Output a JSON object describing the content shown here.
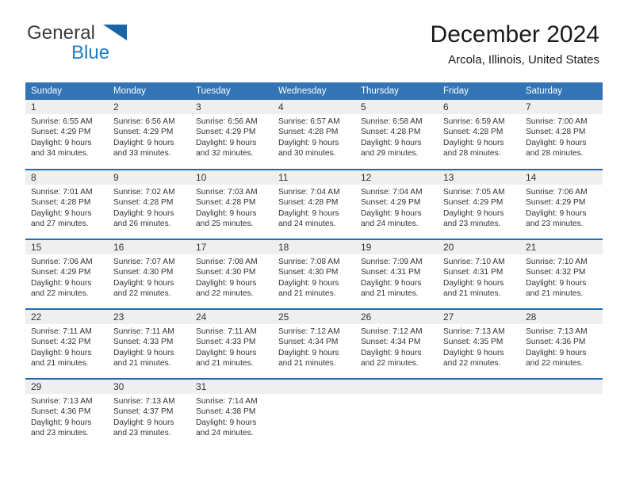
{
  "brand": {
    "name_part1": "General",
    "name_part2": "Blue",
    "triangle_color": "#1666a8",
    "blue_color": "#1f7ec4"
  },
  "header": {
    "title": "December 2024",
    "subtitle": "Arcola, Illinois, United States"
  },
  "theme": {
    "header_row_bg": "#3274b5",
    "header_row_text": "#ffffff",
    "row_divider": "#1f6bb0",
    "daynum_bg": "#efefef",
    "body_text": "#333333"
  },
  "weekday_headers": [
    "Sunday",
    "Monday",
    "Tuesday",
    "Wednesday",
    "Thursday",
    "Friday",
    "Saturday"
  ],
  "weeks": [
    [
      {
        "day": "1",
        "sunrise": "Sunrise: 6:55 AM",
        "sunset": "Sunset: 4:29 PM",
        "daylight_line1": "Daylight: 9 hours",
        "daylight_line2": "and 34 minutes."
      },
      {
        "day": "2",
        "sunrise": "Sunrise: 6:56 AM",
        "sunset": "Sunset: 4:29 PM",
        "daylight_line1": "Daylight: 9 hours",
        "daylight_line2": "and 33 minutes."
      },
      {
        "day": "3",
        "sunrise": "Sunrise: 6:56 AM",
        "sunset": "Sunset: 4:29 PM",
        "daylight_line1": "Daylight: 9 hours",
        "daylight_line2": "and 32 minutes."
      },
      {
        "day": "4",
        "sunrise": "Sunrise: 6:57 AM",
        "sunset": "Sunset: 4:28 PM",
        "daylight_line1": "Daylight: 9 hours",
        "daylight_line2": "and 30 minutes."
      },
      {
        "day": "5",
        "sunrise": "Sunrise: 6:58 AM",
        "sunset": "Sunset: 4:28 PM",
        "daylight_line1": "Daylight: 9 hours",
        "daylight_line2": "and 29 minutes."
      },
      {
        "day": "6",
        "sunrise": "Sunrise: 6:59 AM",
        "sunset": "Sunset: 4:28 PM",
        "daylight_line1": "Daylight: 9 hours",
        "daylight_line2": "and 28 minutes."
      },
      {
        "day": "7",
        "sunrise": "Sunrise: 7:00 AM",
        "sunset": "Sunset: 4:28 PM",
        "daylight_line1": "Daylight: 9 hours",
        "daylight_line2": "and 28 minutes."
      }
    ],
    [
      {
        "day": "8",
        "sunrise": "Sunrise: 7:01 AM",
        "sunset": "Sunset: 4:28 PM",
        "daylight_line1": "Daylight: 9 hours",
        "daylight_line2": "and 27 minutes."
      },
      {
        "day": "9",
        "sunrise": "Sunrise: 7:02 AM",
        "sunset": "Sunset: 4:28 PM",
        "daylight_line1": "Daylight: 9 hours",
        "daylight_line2": "and 26 minutes."
      },
      {
        "day": "10",
        "sunrise": "Sunrise: 7:03 AM",
        "sunset": "Sunset: 4:28 PM",
        "daylight_line1": "Daylight: 9 hours",
        "daylight_line2": "and 25 minutes."
      },
      {
        "day": "11",
        "sunrise": "Sunrise: 7:04 AM",
        "sunset": "Sunset: 4:28 PM",
        "daylight_line1": "Daylight: 9 hours",
        "daylight_line2": "and 24 minutes."
      },
      {
        "day": "12",
        "sunrise": "Sunrise: 7:04 AM",
        "sunset": "Sunset: 4:29 PM",
        "daylight_line1": "Daylight: 9 hours",
        "daylight_line2": "and 24 minutes."
      },
      {
        "day": "13",
        "sunrise": "Sunrise: 7:05 AM",
        "sunset": "Sunset: 4:29 PM",
        "daylight_line1": "Daylight: 9 hours",
        "daylight_line2": "and 23 minutes."
      },
      {
        "day": "14",
        "sunrise": "Sunrise: 7:06 AM",
        "sunset": "Sunset: 4:29 PM",
        "daylight_line1": "Daylight: 9 hours",
        "daylight_line2": "and 23 minutes."
      }
    ],
    [
      {
        "day": "15",
        "sunrise": "Sunrise: 7:06 AM",
        "sunset": "Sunset: 4:29 PM",
        "daylight_line1": "Daylight: 9 hours",
        "daylight_line2": "and 22 minutes."
      },
      {
        "day": "16",
        "sunrise": "Sunrise: 7:07 AM",
        "sunset": "Sunset: 4:30 PM",
        "daylight_line1": "Daylight: 9 hours",
        "daylight_line2": "and 22 minutes."
      },
      {
        "day": "17",
        "sunrise": "Sunrise: 7:08 AM",
        "sunset": "Sunset: 4:30 PM",
        "daylight_line1": "Daylight: 9 hours",
        "daylight_line2": "and 22 minutes."
      },
      {
        "day": "18",
        "sunrise": "Sunrise: 7:08 AM",
        "sunset": "Sunset: 4:30 PM",
        "daylight_line1": "Daylight: 9 hours",
        "daylight_line2": "and 21 minutes."
      },
      {
        "day": "19",
        "sunrise": "Sunrise: 7:09 AM",
        "sunset": "Sunset: 4:31 PM",
        "daylight_line1": "Daylight: 9 hours",
        "daylight_line2": "and 21 minutes."
      },
      {
        "day": "20",
        "sunrise": "Sunrise: 7:10 AM",
        "sunset": "Sunset: 4:31 PM",
        "daylight_line1": "Daylight: 9 hours",
        "daylight_line2": "and 21 minutes."
      },
      {
        "day": "21",
        "sunrise": "Sunrise: 7:10 AM",
        "sunset": "Sunset: 4:32 PM",
        "daylight_line1": "Daylight: 9 hours",
        "daylight_line2": "and 21 minutes."
      }
    ],
    [
      {
        "day": "22",
        "sunrise": "Sunrise: 7:11 AM",
        "sunset": "Sunset: 4:32 PM",
        "daylight_line1": "Daylight: 9 hours",
        "daylight_line2": "and 21 minutes."
      },
      {
        "day": "23",
        "sunrise": "Sunrise: 7:11 AM",
        "sunset": "Sunset: 4:33 PM",
        "daylight_line1": "Daylight: 9 hours",
        "daylight_line2": "and 21 minutes."
      },
      {
        "day": "24",
        "sunrise": "Sunrise: 7:11 AM",
        "sunset": "Sunset: 4:33 PM",
        "daylight_line1": "Daylight: 9 hours",
        "daylight_line2": "and 21 minutes."
      },
      {
        "day": "25",
        "sunrise": "Sunrise: 7:12 AM",
        "sunset": "Sunset: 4:34 PM",
        "daylight_line1": "Daylight: 9 hours",
        "daylight_line2": "and 21 minutes."
      },
      {
        "day": "26",
        "sunrise": "Sunrise: 7:12 AM",
        "sunset": "Sunset: 4:34 PM",
        "daylight_line1": "Daylight: 9 hours",
        "daylight_line2": "and 22 minutes."
      },
      {
        "day": "27",
        "sunrise": "Sunrise: 7:13 AM",
        "sunset": "Sunset: 4:35 PM",
        "daylight_line1": "Daylight: 9 hours",
        "daylight_line2": "and 22 minutes."
      },
      {
        "day": "28",
        "sunrise": "Sunrise: 7:13 AM",
        "sunset": "Sunset: 4:36 PM",
        "daylight_line1": "Daylight: 9 hours",
        "daylight_line2": "and 22 minutes."
      }
    ],
    [
      {
        "day": "29",
        "sunrise": "Sunrise: 7:13 AM",
        "sunset": "Sunset: 4:36 PM",
        "daylight_line1": "Daylight: 9 hours",
        "daylight_line2": "and 23 minutes."
      },
      {
        "day": "30",
        "sunrise": "Sunrise: 7:13 AM",
        "sunset": "Sunset: 4:37 PM",
        "daylight_line1": "Daylight: 9 hours",
        "daylight_line2": "and 23 minutes."
      },
      {
        "day": "31",
        "sunrise": "Sunrise: 7:14 AM",
        "sunset": "Sunset: 4:38 PM",
        "daylight_line1": "Daylight: 9 hours",
        "daylight_line2": "and 24 minutes."
      },
      {
        "day": "",
        "sunrise": "",
        "sunset": "",
        "daylight_line1": "",
        "daylight_line2": ""
      },
      {
        "day": "",
        "sunrise": "",
        "sunset": "",
        "daylight_line1": "",
        "daylight_line2": ""
      },
      {
        "day": "",
        "sunrise": "",
        "sunset": "",
        "daylight_line1": "",
        "daylight_line2": ""
      },
      {
        "day": "",
        "sunrise": "",
        "sunset": "",
        "daylight_line1": "",
        "daylight_line2": ""
      }
    ]
  ]
}
